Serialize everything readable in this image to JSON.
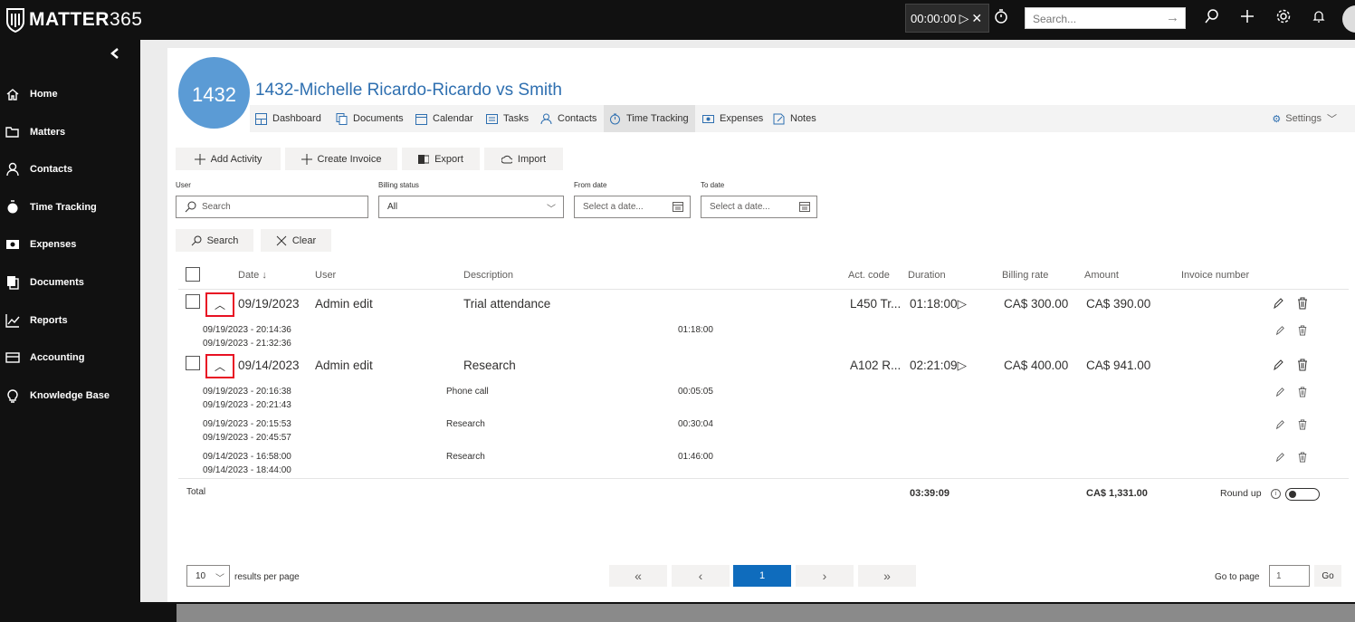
{
  "app": {
    "logo_main": "MATTER",
    "logo_num": "365"
  },
  "topbar": {
    "timer": "00:00:00",
    "search_placeholder": "Search..."
  },
  "sidebar": {
    "items": [
      {
        "label": "Home"
      },
      {
        "label": "Matters"
      },
      {
        "label": "Contacts"
      },
      {
        "label": "Time Tracking"
      },
      {
        "label": "Expenses"
      },
      {
        "label": "Documents"
      },
      {
        "label": "Reports"
      },
      {
        "label": "Accounting"
      },
      {
        "label": "Knowledge Base"
      }
    ]
  },
  "matter": {
    "badge": "1432",
    "title": "1432-Michelle Ricardo-Ricardo vs Smith"
  },
  "tabs": [
    {
      "label": "Dashboard"
    },
    {
      "label": "Documents"
    },
    {
      "label": "Calendar"
    },
    {
      "label": "Tasks"
    },
    {
      "label": "Contacts"
    },
    {
      "label": "Time Tracking"
    },
    {
      "label": "Expenses"
    },
    {
      "label": "Notes"
    }
  ],
  "settings_label": "Settings",
  "toolbar": {
    "add_activity": "Add Activity",
    "create_invoice": "Create Invoice",
    "export": "Export",
    "import": "Import"
  },
  "filters": {
    "user_label": "User",
    "user_placeholder": "Search",
    "billing_label": "Billing status",
    "billing_value": "All",
    "from_label": "From date",
    "from_placeholder": "Select a date...",
    "to_label": "To date",
    "to_placeholder": "Select a date...",
    "search_btn": "Search",
    "clear_btn": "Clear"
  },
  "table": {
    "headers": {
      "date": "Date",
      "user": "User",
      "description": "Description",
      "act_code": "Act. code",
      "duration": "Duration",
      "billing_rate": "Billing rate",
      "amount": "Amount",
      "invoice_number": "Invoice number"
    },
    "rows": [
      {
        "date": "09/19/2023",
        "user": "Admin edit",
        "description": "Trial attendance",
        "act_code": "L450 Tr...",
        "duration": "01:18:00",
        "rate": "CA$ 300.00",
        "amount": "CA$ 390.00",
        "entries": [
          {
            "start": "09/19/2023 - 20:14:36",
            "end": "09/19/2023 - 21:32:36",
            "desc": "",
            "duration": "01:18:00"
          }
        ]
      },
      {
        "date": "09/14/2023",
        "user": "Admin edit",
        "description": "Research",
        "act_code": "A102 R...",
        "duration": "02:21:09",
        "rate": "CA$ 400.00",
        "amount": "CA$ 941.00",
        "entries": [
          {
            "start": "09/19/2023 - 20:16:38",
            "end": "09/19/2023 - 20:21:43",
            "desc": "Phone call",
            "duration": "00:05:05"
          },
          {
            "start": "09/19/2023 - 20:15:53",
            "end": "09/19/2023 - 20:45:57",
            "desc": "Research",
            "duration": "00:30:04"
          },
          {
            "start": "09/14/2023 - 16:58:00",
            "end": "09/14/2023 - 18:44:00",
            "desc": "Research",
            "duration": "01:46:00"
          }
        ]
      }
    ],
    "total": {
      "label": "Total",
      "duration": "03:39:09",
      "amount": "CA$ 1,331.00",
      "round_up": "Round up"
    }
  },
  "pagination": {
    "per_page": "10",
    "per_page_label": "results per page",
    "current": "1",
    "go_to_label": "Go to page",
    "go_value": "1",
    "go_btn": "Go"
  },
  "colors": {
    "accent": "#0f6cbd",
    "badge": "#5b9bd5",
    "title": "#2e6fb0",
    "highlight": "#e81123"
  }
}
